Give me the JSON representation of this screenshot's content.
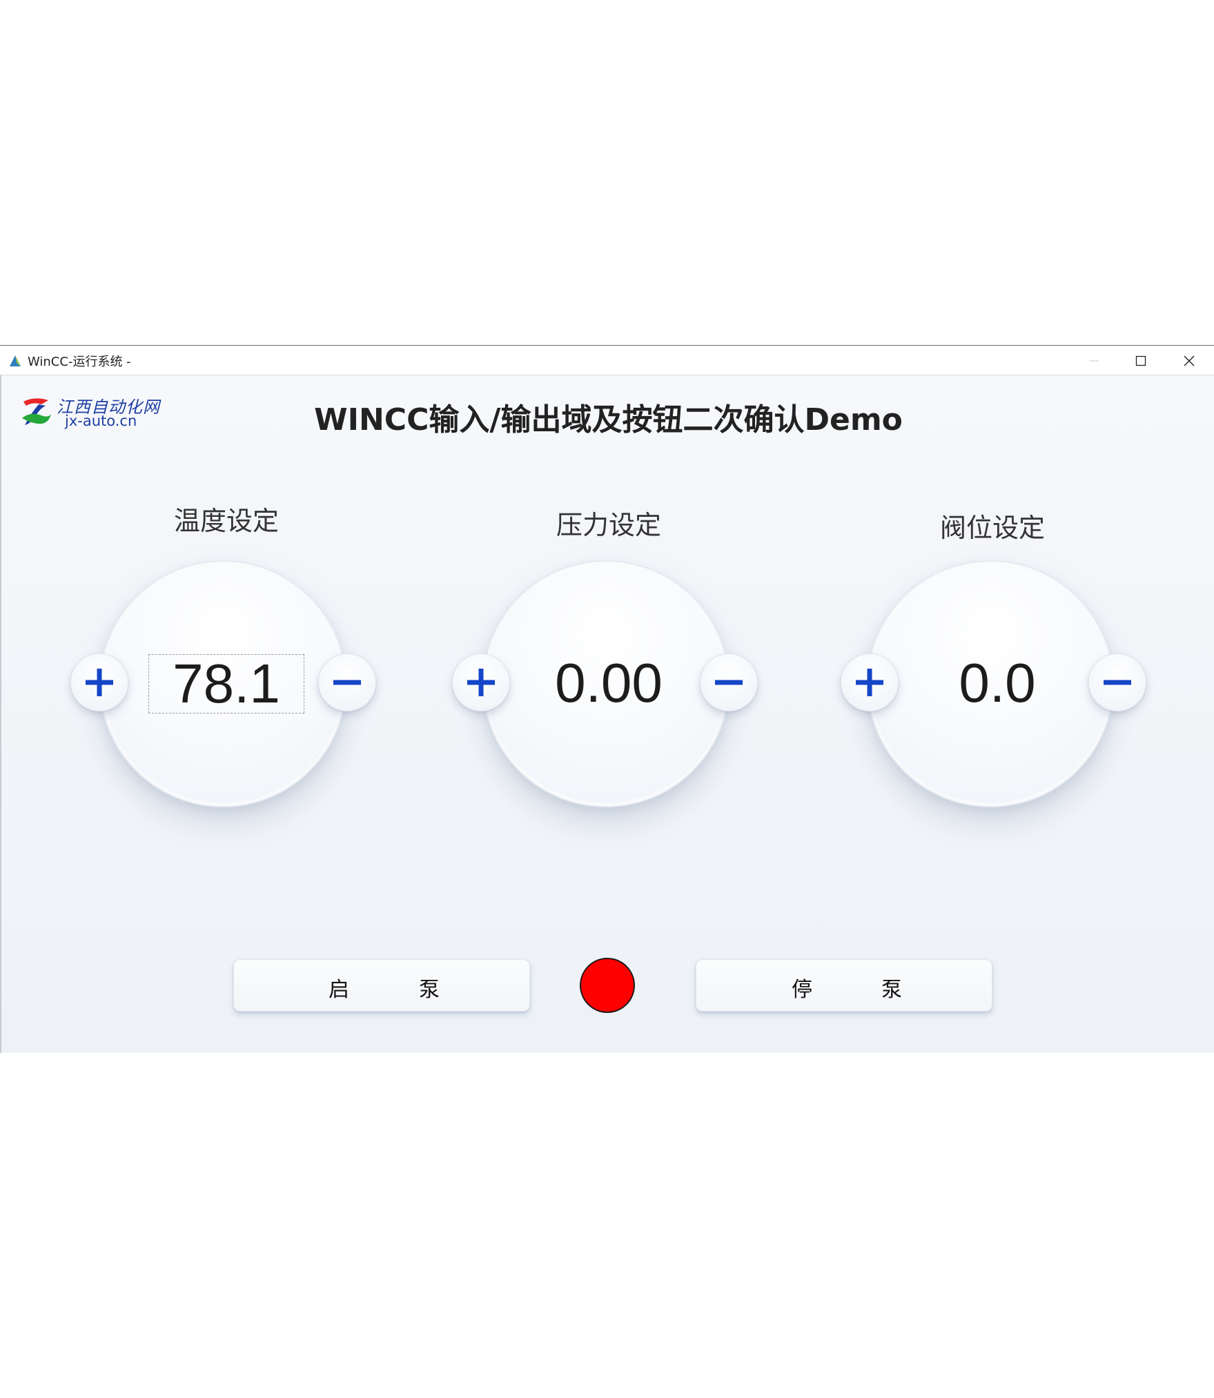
{
  "window": {
    "title": "WinCC-运行系统 -"
  },
  "logo": {
    "name_cn": "江西自动化网",
    "url": "jx-auto.cn"
  },
  "page_title": "WINCC输入/输出域及按钮二次确认Demo",
  "groups": [
    {
      "label": "温度设定",
      "value": "78.1",
      "plus_icon": "plus-icon",
      "minus_icon": "minus-icon"
    },
    {
      "label": "压力设定",
      "value": "0.00",
      "plus_icon": "plus-icon",
      "minus_icon": "minus-icon"
    },
    {
      "label": "阀位设定",
      "value": "0.0",
      "plus_icon": "plus-icon",
      "minus_icon": "minus-icon"
    }
  ],
  "buttons": {
    "start_pump": {
      "char1": "启",
      "char2": "泵"
    },
    "stop_pump": {
      "char1": "停",
      "char2": "泵"
    }
  },
  "colors": {
    "icon_blue": "#1446c8",
    "indicator": "#ff0000",
    "logo_blue": "#1d3ea3"
  }
}
